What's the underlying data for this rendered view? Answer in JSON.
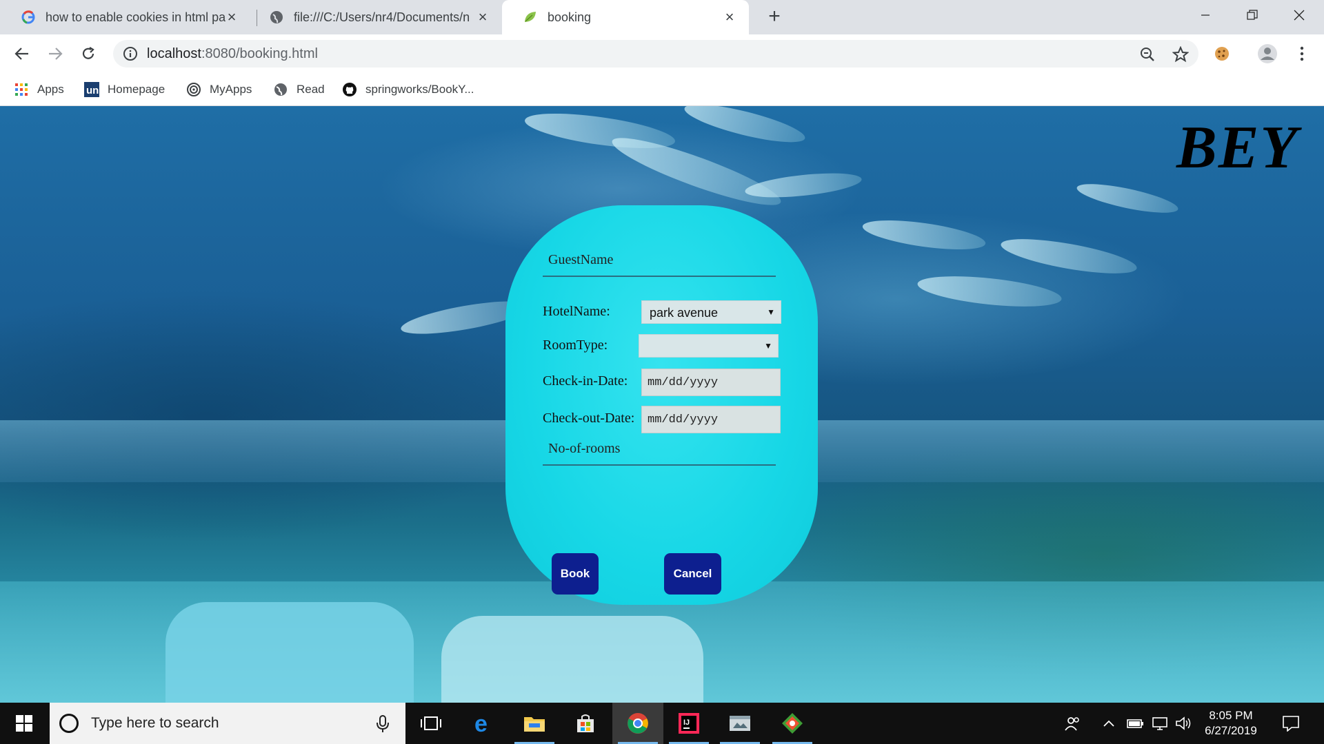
{
  "browser": {
    "tabs": [
      {
        "title": "how to enable cookies in html pa",
        "icon": "google-icon"
      },
      {
        "title": "file:///C:/Users/nr4/Documents/n",
        "icon": "globe-icon"
      },
      {
        "title": "booking",
        "icon": "leaf-icon"
      }
    ],
    "address": {
      "host": "localhost",
      "path": ":8080/booking.html"
    },
    "bookmarks": [
      {
        "label": "Apps",
        "icon": "apps-grid-icon"
      },
      {
        "label": "Homepage",
        "icon": "unext-icon"
      },
      {
        "label": "MyApps",
        "icon": "myapps-icon"
      },
      {
        "label": "Read",
        "icon": "globe-icon"
      },
      {
        "label": "springworks/BookY...",
        "icon": "github-icon"
      }
    ]
  },
  "page": {
    "brand": "BEY",
    "form": {
      "guest_name_placeholder": "GuestName",
      "hotel_label": "HotelName:",
      "hotel_selected": "park avenue",
      "room_label": "RoomType:",
      "room_selected": "",
      "checkin_label": "Check-in-Date:",
      "checkin_placeholder": "mm/dd/yyyy",
      "checkout_label": "Check-out-Date:",
      "checkout_placeholder": "mm/dd/yyyy",
      "rooms_placeholder": "No-of-rooms",
      "book_label": "Book",
      "cancel_label": "Cancel"
    },
    "colors": {
      "card": "#17d7e6",
      "button": "#0d1f8f"
    }
  },
  "taskbar": {
    "search_placeholder": "Type here to search",
    "time": "8:05 PM",
    "date": "6/27/2019"
  }
}
